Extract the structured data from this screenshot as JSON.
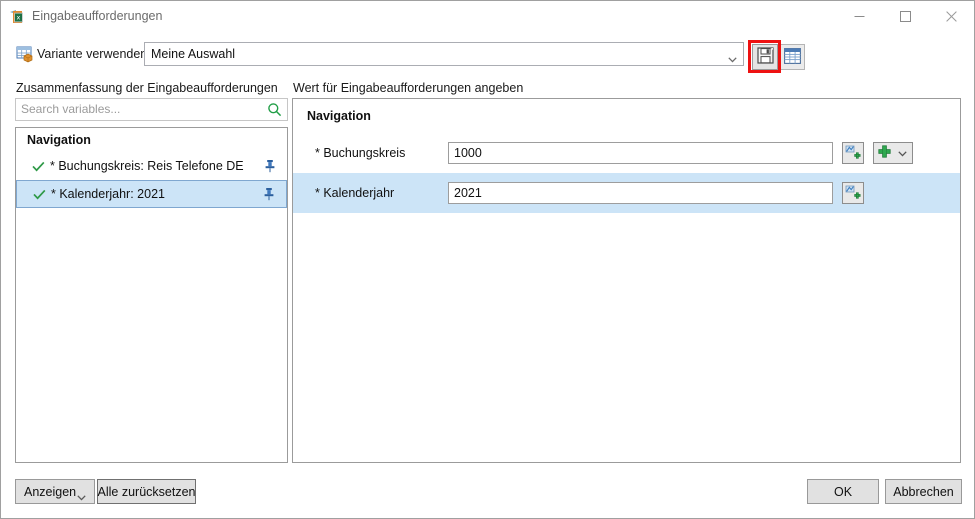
{
  "window": {
    "title": "Eingabeaufforderungen",
    "app_icon": "excel-prompt-icon",
    "minimize": "minimize-icon",
    "maximize": "maximize-icon",
    "close": "close-icon"
  },
  "variant_bar": {
    "icon": "variant-table-icon",
    "label": "Variante verwenden",
    "combo_value": "Meine Auswahl",
    "save_button_title": "save-icon",
    "grid_button_title": "table-grid-icon",
    "highlight_color": "#ee1111"
  },
  "left_panel": {
    "caption": "Zusammenfassung der Eingabeaufforderungen",
    "search_placeholder": "Search variables...",
    "search_value": "",
    "search_icon": "search-icon",
    "group_label": "Navigation",
    "items": [
      {
        "label": "* Buchungskreis: Reis Telefone DE",
        "checked": true,
        "pinned": true,
        "selected": false
      },
      {
        "label": "* Kalenderjahr: 2021",
        "checked": true,
        "pinned": true,
        "selected": true
      }
    ]
  },
  "right_panel": {
    "caption": "Wert für Eingabeaufforderungen angeben",
    "group_label": "Navigation",
    "fields": [
      {
        "label": "* Buchungskreis",
        "value": "1000",
        "highlighted": false,
        "value_help_icon": "value-help-icon",
        "add_icon": "add-plus-icon",
        "add_caret": "chevron-down-icon",
        "has_add_button": true
      },
      {
        "label": "* Kalenderjahr",
        "value": "2021",
        "highlighted": true,
        "value_help_icon": "value-help-icon",
        "has_add_button": false
      }
    ]
  },
  "footer": {
    "show_label": "Anzeigen",
    "reset_label": "Alle zurücksetzen",
    "ok_label": "OK",
    "cancel_label": "Abbrechen"
  },
  "colors": {
    "selection_blue": "#cce4f7",
    "selection_border": "#7fa7d0",
    "accent_green": "#2e8b3d",
    "pin_blue": "#2b5f9e"
  }
}
